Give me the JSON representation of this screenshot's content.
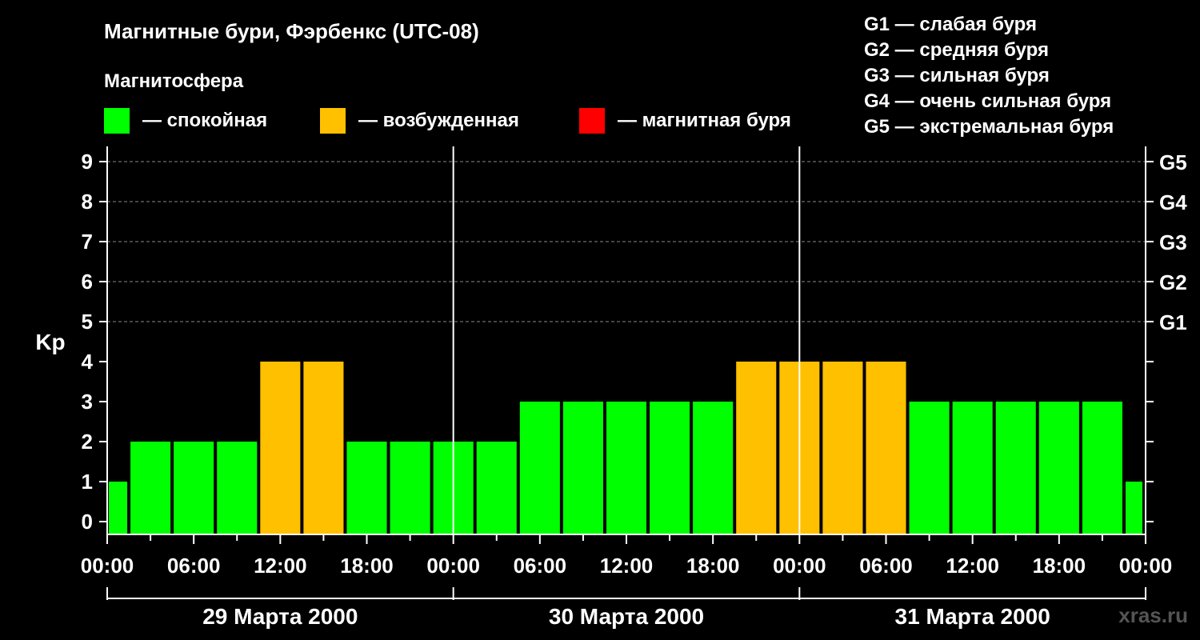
{
  "header": {
    "title": "Магнитные бури, Фэрбенкс (UTC-08)",
    "magnetosphere_label": "Магнитосфера"
  },
  "legend": {
    "items": [
      {
        "label": "— спокойная",
        "color": "#00ff00"
      },
      {
        "label": "— возбужденная",
        "color": "#ffc000"
      },
      {
        "label": "— магнитная буря",
        "color": "#ff0000"
      }
    ],
    "storm_levels": [
      "G1 — слабая буря",
      "G2 — средняя буря",
      "G3 — сильная буря",
      "G4 — очень сильная буря",
      "G5 — экстремальная буря"
    ]
  },
  "watermark": "xras.ru",
  "chart_data": {
    "type": "bar",
    "ylabel": "Kp",
    "ylim": [
      0,
      9
    ],
    "y_ticks": [
      "0",
      "1",
      "2",
      "3",
      "4",
      "5",
      "6",
      "7",
      "8",
      "9"
    ],
    "right_axis_labels": [
      {
        "kp": 5,
        "label": "G1"
      },
      {
        "kp": 6,
        "label": "G2"
      },
      {
        "kp": 7,
        "label": "G3"
      },
      {
        "kp": 8,
        "label": "G4"
      },
      {
        "kp": 9,
        "label": "G5"
      }
    ],
    "x_tick_labels": [
      "00:00",
      "06:00",
      "12:00",
      "18:00",
      "00:00",
      "06:00",
      "12:00",
      "18:00",
      "00:00",
      "06:00",
      "12:00",
      "18:00",
      "00:00"
    ],
    "days": [
      "29 Марта 2000",
      "30 Марта 2000",
      "31 Марта 2000"
    ],
    "interval_hours": 3,
    "values": [
      1,
      2,
      2,
      2,
      4,
      4,
      2,
      2,
      2,
      2,
      3,
      3,
      3,
      3,
      3,
      4,
      4,
      4,
      4,
      3,
      3,
      3,
      3,
      3,
      1
    ],
    "grid": true,
    "colors": {
      "quiet": "#00ff00",
      "unsettled": "#ffc000",
      "storm": "#ff0000",
      "grid": "#888888"
    }
  }
}
